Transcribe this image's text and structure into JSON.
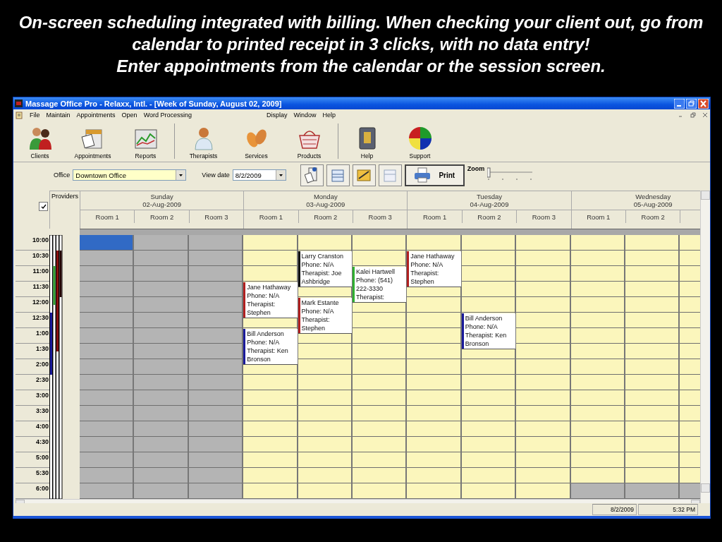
{
  "caption": [
    "On-screen scheduling integrated with billing. When checking your client out, go from calendar to printed receipt in 3 clicks, with no data entry!",
    "Enter appointments from the calendar or the session screen."
  ],
  "window": {
    "title": "Massage Office Pro - Relaxx, Intl. - [Week of Sunday, August 02, 2009]"
  },
  "menu_left": [
    "File",
    "Maintain",
    "Appointments",
    "Open",
    "Word Processing"
  ],
  "menu_right": [
    "Display",
    "Window",
    "Help"
  ],
  "toolbar_groups": [
    {
      "buttons": [
        "Clients",
        "Appointments",
        "Reports"
      ]
    },
    {
      "buttons": [
        "Therapists",
        "Services",
        "Products"
      ]
    },
    {
      "buttons": [
        "Help",
        "Support"
      ]
    }
  ],
  "options": {
    "office_label": "Office",
    "office": "Downtown Office",
    "date_label": "View date",
    "date": "8/2/2009",
    "print": "Print",
    "zoom": {
      "label": "Zoom",
      "level": 0
    }
  },
  "providers": {
    "label": "Providers",
    "checked": true
  },
  "times": [
    "10:00",
    "10:30",
    "11:00",
    "11:30",
    "12:00",
    "12:30",
    "1:00",
    "1:30",
    "2:00",
    "2:30",
    "3:00",
    "3:30",
    "4:00",
    "4:30",
    "5:00",
    "5:30",
    "6:00"
  ],
  "days": [
    {
      "name": "Sunday",
      "date": "02-Aug-2009",
      "rooms": [
        {
          "label": "Room 1",
          "slots": [
            {
              "kind": "selected"
            },
            {
              "kind": "closed"
            },
            {
              "kind": "closed"
            },
            {
              "kind": "closed"
            },
            {
              "kind": "closed"
            },
            {
              "kind": "closed"
            },
            {
              "kind": "closed"
            },
            {
              "kind": "closed"
            },
            {
              "kind": "closed"
            },
            {
              "kind": "closed"
            },
            {
              "kind": "closed"
            },
            {
              "kind": "closed"
            },
            {
              "kind": "closed"
            },
            {
              "kind": "closed"
            },
            {
              "kind": "closed"
            },
            {
              "kind": "closed"
            },
            {
              "kind": "closed"
            }
          ]
        },
        {
          "label": "Room 2",
          "slots": [
            {
              "kind": "closed"
            },
            {
              "kind": "closed"
            },
            {
              "kind": "closed"
            },
            {
              "kind": "closed"
            },
            {
              "kind": "closed"
            },
            {
              "kind": "closed"
            },
            {
              "kind": "closed"
            },
            {
              "kind": "closed"
            },
            {
              "kind": "closed"
            },
            {
              "kind": "closed"
            },
            {
              "kind": "closed"
            },
            {
              "kind": "closed"
            },
            {
              "kind": "closed"
            },
            {
              "kind": "closed"
            },
            {
              "kind": "closed"
            },
            {
              "kind": "closed"
            },
            {
              "kind": "closed"
            }
          ]
        },
        {
          "label": "Room 3",
          "slots": [
            {
              "kind": "closed"
            },
            {
              "kind": "closed"
            },
            {
              "kind": "closed"
            },
            {
              "kind": "closed"
            },
            {
              "kind": "closed"
            },
            {
              "kind": "closed"
            },
            {
              "kind": "closed"
            },
            {
              "kind": "closed"
            },
            {
              "kind": "closed"
            },
            {
              "kind": "closed"
            },
            {
              "kind": "closed"
            },
            {
              "kind": "closed"
            },
            {
              "kind": "closed"
            },
            {
              "kind": "closed"
            },
            {
              "kind": "closed"
            },
            {
              "kind": "closed"
            },
            {
              "kind": "closed"
            }
          ]
        }
      ]
    },
    {
      "name": "Monday",
      "date": "03-Aug-2009",
      "rooms": [
        {
          "label": "Room 1",
          "slots": [
            {
              "kind": "free"
            },
            {
              "kind": "free"
            },
            {
              "kind": "free"
            },
            {
              "kind": "booking",
              "client": "Jane Hathaway",
              "phone": "Phone: N/A",
              "therapist": "Therapist: Stephen",
              "color": "#b02020"
            },
            {
              "kind": "free"
            },
            {
              "kind": "booking",
              "client": "Bill Anderson",
              "phone": "Phone: N/A",
              "therapist": "Therapist: Ken Bronson",
              "color": "#1a1a9a"
            },
            {
              "kind": "free"
            },
            {
              "kind": "free"
            },
            {
              "kind": "free"
            },
            {
              "kind": "free"
            },
            {
              "kind": "free"
            },
            {
              "kind": "free"
            },
            {
              "kind": "free"
            }
          ]
        },
        {
          "label": "Room 2",
          "slots": [
            {
              "kind": "free"
            },
            {
              "kind": "booking",
              "client": "Larry Cranston",
              "phone": "Phone: N/A",
              "therapist": "Therapist: Joe Ashbridge",
              "color": "#101010"
            },
            {
              "kind": "free"
            },
            {
              "kind": "booking",
              "client": "Mark Estante",
              "phone": "Phone: N/A",
              "therapist": "Therapist: Stephen",
              "color": "#b02020"
            },
            {
              "kind": "free"
            },
            {
              "kind": "free"
            },
            {
              "kind": "free"
            },
            {
              "kind": "free"
            },
            {
              "kind": "free"
            },
            {
              "kind": "free"
            },
            {
              "kind": "free"
            },
            {
              "kind": "free"
            },
            {
              "kind": "free"
            }
          ]
        },
        {
          "label": "Room 3",
          "slots": [
            {
              "kind": "free"
            },
            {
              "kind": "free"
            },
            {
              "kind": "booking",
              "client": "Kalei Hartwell",
              "phone": "Phone: (541) 222-3330",
              "therapist": "Therapist:",
              "color": "#30b030"
            },
            {
              "kind": "free"
            },
            {
              "kind": "free"
            },
            {
              "kind": "free"
            },
            {
              "kind": "free"
            },
            {
              "kind": "free"
            },
            {
              "kind": "free"
            },
            {
              "kind": "free"
            },
            {
              "kind": "free"
            },
            {
              "kind": "free"
            },
            {
              "kind": "free"
            },
            {
              "kind": "free"
            },
            {
              "kind": "free"
            }
          ]
        }
      ]
    },
    {
      "name": "Tuesday",
      "date": "04-Aug-2009",
      "rooms": [
        {
          "label": "Room 1",
          "slots": [
            {
              "kind": "free"
            },
            {
              "kind": "booking",
              "client": "Jane Hathaway",
              "phone": "Phone: N/A",
              "therapist": "Therapist: Stephen",
              "color": "#b02020"
            },
            {
              "kind": "free"
            },
            {
              "kind": "free"
            },
            {
              "kind": "free"
            },
            {
              "kind": "free"
            },
            {
              "kind": "free"
            },
            {
              "kind": "free"
            },
            {
              "kind": "free"
            },
            {
              "kind": "free"
            },
            {
              "kind": "free"
            },
            {
              "kind": "free"
            },
            {
              "kind": "free"
            },
            {
              "kind": "free"
            },
            {
              "kind": "free"
            }
          ]
        },
        {
          "label": "Room 2",
          "slots": [
            {
              "kind": "free"
            },
            {
              "kind": "free"
            },
            {
              "kind": "free"
            },
            {
              "kind": "free"
            },
            {
              "kind": "free"
            },
            {
              "kind": "booking",
              "client": "Bill Anderson",
              "phone": "Phone: N/A",
              "therapist": "Therapist: Ken Bronson",
              "color": "#1a1a9a"
            },
            {
              "kind": "free"
            },
            {
              "kind": "free"
            },
            {
              "kind": "free"
            },
            {
              "kind": "free"
            },
            {
              "kind": "free"
            },
            {
              "kind": "free"
            },
            {
              "kind": "free"
            },
            {
              "kind": "free"
            },
            {
              "kind": "free"
            }
          ]
        },
        {
          "label": "Room 3",
          "slots": [
            {
              "kind": "free"
            },
            {
              "kind": "free"
            },
            {
              "kind": "free"
            },
            {
              "kind": "free"
            },
            {
              "kind": "free"
            },
            {
              "kind": "free"
            },
            {
              "kind": "free"
            },
            {
              "kind": "free"
            },
            {
              "kind": "free"
            },
            {
              "kind": "free"
            },
            {
              "kind": "free"
            },
            {
              "kind": "free"
            },
            {
              "kind": "free"
            },
            {
              "kind": "free"
            },
            {
              "kind": "free"
            },
            {
              "kind": "free"
            },
            {
              "kind": "free"
            }
          ]
        }
      ]
    },
    {
      "name": "Wednesday",
      "date": "05-Aug-2009",
      "rooms": [
        {
          "label": "Room 1",
          "slots": [
            {
              "kind": "free"
            },
            {
              "kind": "free"
            },
            {
              "kind": "free"
            },
            {
              "kind": "free"
            },
            {
              "kind": "free"
            },
            {
              "kind": "free"
            },
            {
              "kind": "free"
            },
            {
              "kind": "free"
            },
            {
              "kind": "free"
            },
            {
              "kind": "free"
            },
            {
              "kind": "free"
            },
            {
              "kind": "free"
            },
            {
              "kind": "free"
            },
            {
              "kind": "free"
            },
            {
              "kind": "free"
            },
            {
              "kind": "free"
            },
            {
              "kind": "closed"
            }
          ]
        },
        {
          "label": "Room 2",
          "slots": [
            {
              "kind": "free"
            },
            {
              "kind": "free"
            },
            {
              "kind": "free"
            },
            {
              "kind": "free"
            },
            {
              "kind": "free"
            },
            {
              "kind": "free"
            },
            {
              "kind": "free"
            },
            {
              "kind": "free"
            },
            {
              "kind": "free"
            },
            {
              "kind": "free"
            },
            {
              "kind": "free"
            },
            {
              "kind": "free"
            },
            {
              "kind": "free"
            },
            {
              "kind": "free"
            },
            {
              "kind": "free"
            },
            {
              "kind": "free"
            },
            {
              "kind": "closed"
            }
          ]
        },
        {
          "slots": [
            {
              "kind": "free"
            },
            {
              "kind": "free"
            },
            {
              "kind": "free"
            },
            {
              "kind": "free"
            },
            {
              "kind": "free"
            },
            {
              "kind": "free"
            },
            {
              "kind": "free"
            },
            {
              "kind": "free"
            },
            {
              "kind": "free"
            },
            {
              "kind": "free"
            },
            {
              "kind": "free"
            },
            {
              "kind": "free"
            },
            {
              "kind": "free"
            },
            {
              "kind": "free"
            },
            {
              "kind": "free"
            },
            {
              "kind": "free"
            },
            {
              "kind": "closed"
            }
          ]
        }
      ]
    }
  ],
  "status_bar": {
    "date": "8/2/2009",
    "time": "5:32 PM"
  }
}
